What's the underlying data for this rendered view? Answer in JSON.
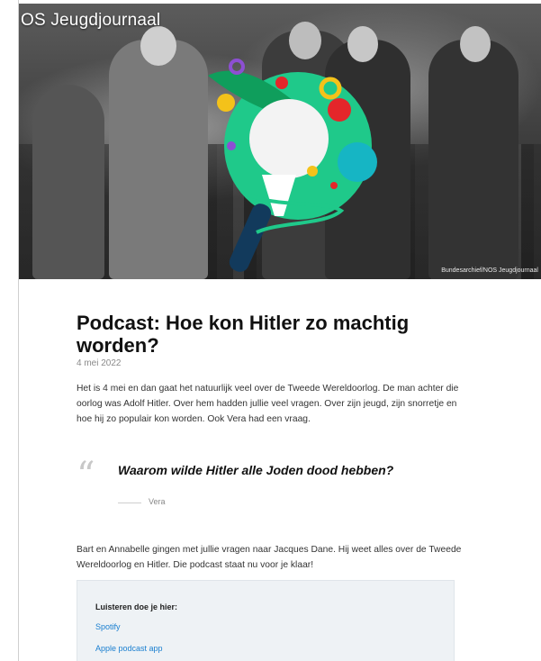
{
  "hero": {
    "logo_text": "OS Jeugdjournaal",
    "photo_credit": "Bundesarchief/NOS Jeugdjournaal",
    "brand_colors": {
      "green": "#1fc98a",
      "teal": "#16b5c4",
      "navy": "#123a5c",
      "red": "#e4262a",
      "yellow": "#f4c21a",
      "purple": "#8d4fd3"
    }
  },
  "article": {
    "title": "Podcast: Hoe kon Hitler zo machtig worden?",
    "date": "4 mei 2022",
    "intro": "Het is 4 mei en dan gaat het natuurlijk veel over de Tweede Wereldoorlog. De man achter die oorlog was Adolf Hitler. Over hem hadden jullie veel vragen. Over zijn jeugd, zijn snorretje en hoe hij zo populair kon worden. Ook Vera had een vraag.",
    "quote": {
      "mark": "“",
      "text": "Waarom wilde Hitler alle Joden dood hebben?",
      "author": "Vera"
    },
    "paragraph2": "Bart en Annabelle gingen met jullie vragen naar Jacques Dane. Hij weet alles over de Tweede Wereldoorlog en Hitler. Die podcast staat nu voor je klaar!",
    "listen": {
      "heading": "Luisteren doe je hier:",
      "links": [
        "Spotify",
        "Apple podcast app"
      ]
    }
  }
}
